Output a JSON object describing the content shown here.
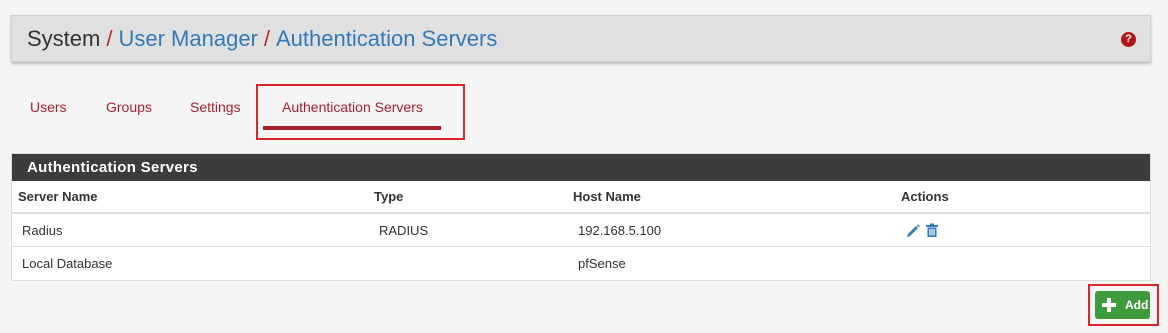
{
  "breadcrumb": {
    "root": "System",
    "separator": "/",
    "items": [
      "User Manager",
      "Authentication Servers"
    ]
  },
  "help_icon": "question-circle-icon",
  "tabs": [
    {
      "label": "Users"
    },
    {
      "label": "Groups"
    },
    {
      "label": "Settings"
    },
    {
      "label": "Authentication Servers",
      "active": true
    }
  ],
  "panel": {
    "title": "Authentication Servers",
    "columns": [
      "Server Name",
      "Type",
      "Host Name",
      "Actions"
    ],
    "rows": [
      {
        "name": "Radius",
        "type": "RADIUS",
        "host": "192.168.5.100",
        "actions": [
          "edit-pencil-icon",
          "delete-trash-icon"
        ]
      },
      {
        "name": "Local Database",
        "type": "",
        "host": "pfSense",
        "actions": []
      }
    ]
  },
  "add_button": {
    "label": "Add",
    "icon": "plus-icon"
  },
  "colors": {
    "accent_red": "#a5232b",
    "link_blue": "#337ab7",
    "panel_heading": "#3c3c3c",
    "add_green": "#3f9a3c",
    "highlight_red": "#d9262b"
  }
}
